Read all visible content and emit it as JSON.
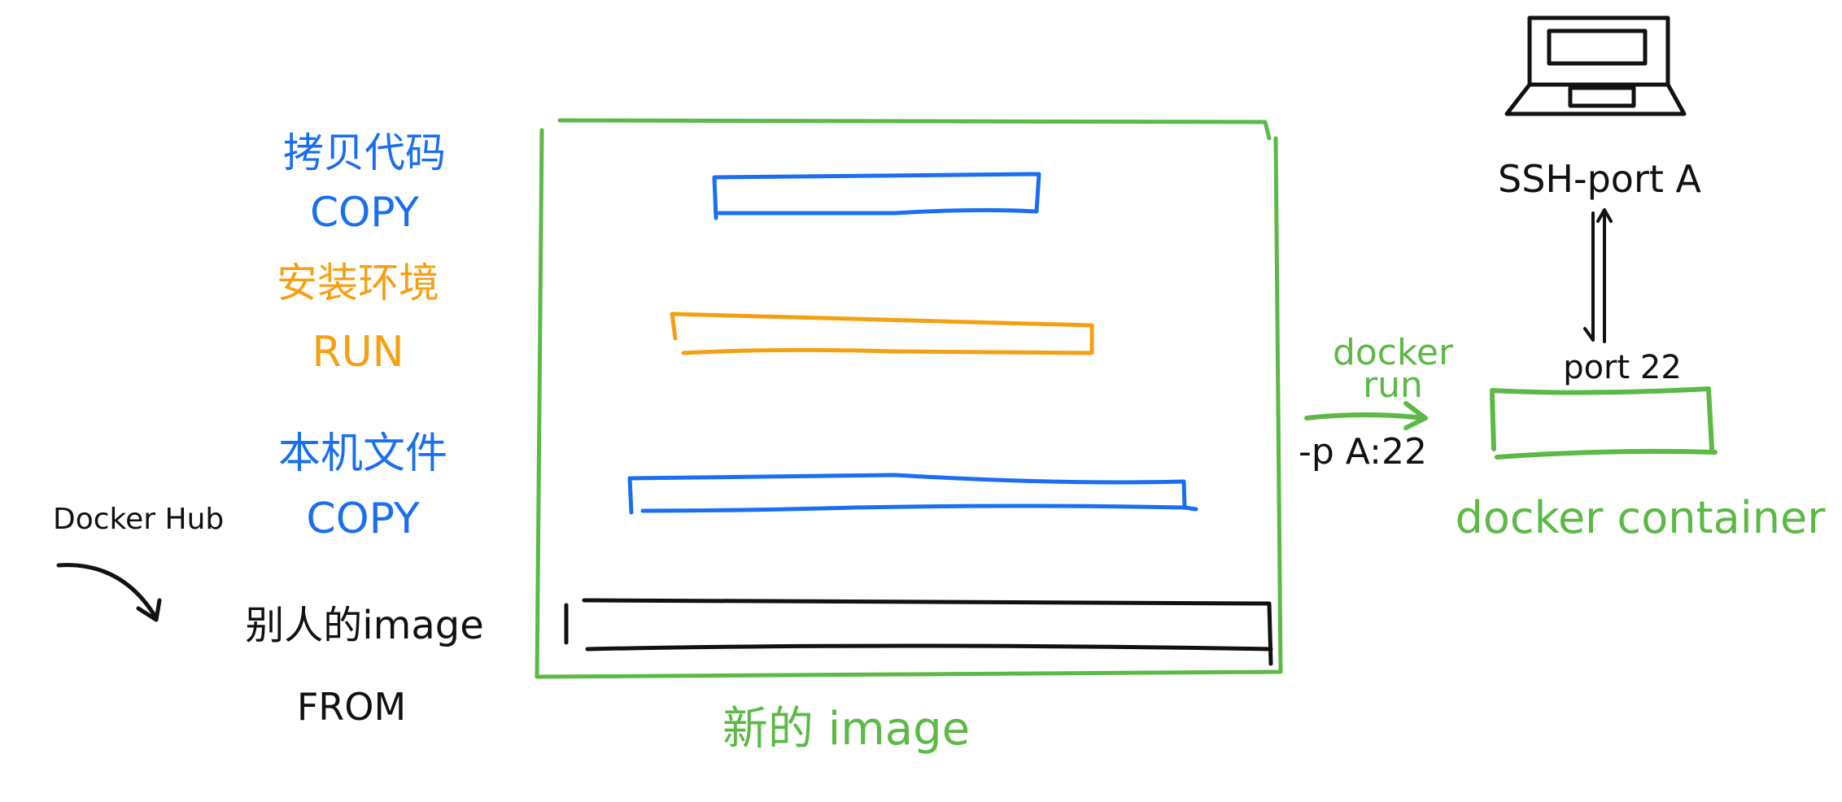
{
  "colors": {
    "blue": "#1a6ff0",
    "orange": "#f5a012",
    "green": "#5cb946",
    "black": "#111111"
  },
  "layers": [
    {
      "label_cn": "拷贝代码",
      "label_cmd": "COPY",
      "color": "blue"
    },
    {
      "label_cn": "安装环境",
      "label_cmd": "RUN",
      "color": "orange"
    },
    {
      "label_cn": "本机文件",
      "label_cmd": "COPY",
      "color": "blue"
    },
    {
      "label_cn": "别人的image",
      "label_cmd": "FROM",
      "color": "black"
    }
  ],
  "docker_hub": "Docker Hub",
  "new_image_label": "新的 image",
  "docker_run": {
    "line1": "docker",
    "line2": "run",
    "option": "-p A:22"
  },
  "host": {
    "icon": "laptop-icon",
    "label": "SSH-port A"
  },
  "container": {
    "port_label": "port 22",
    "label": "docker container"
  }
}
